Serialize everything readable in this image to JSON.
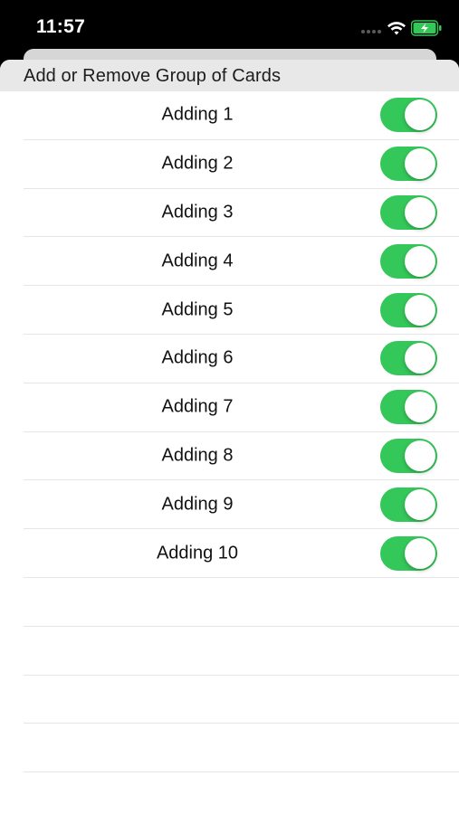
{
  "status_bar": {
    "time": "11:57",
    "icons": [
      "signal-dots-icon",
      "wifi-icon",
      "battery-charging-icon"
    ]
  },
  "colors": {
    "toggle_on": "#34c759",
    "header_bg": "#e8e8e9",
    "battery": "#34c759"
  },
  "header": {
    "title": "Add or Remove Group of Cards"
  },
  "rows": [
    {
      "label": "Adding 1",
      "on": true
    },
    {
      "label": "Adding 2",
      "on": true
    },
    {
      "label": "Adding 3",
      "on": true
    },
    {
      "label": "Adding 4",
      "on": true
    },
    {
      "label": "Adding 5",
      "on": true
    },
    {
      "label": "Adding 6",
      "on": true
    },
    {
      "label": "Adding 7",
      "on": true
    },
    {
      "label": "Adding 8",
      "on": true
    },
    {
      "label": "Adding 9",
      "on": true
    },
    {
      "label": "Adding 10",
      "on": true
    }
  ]
}
